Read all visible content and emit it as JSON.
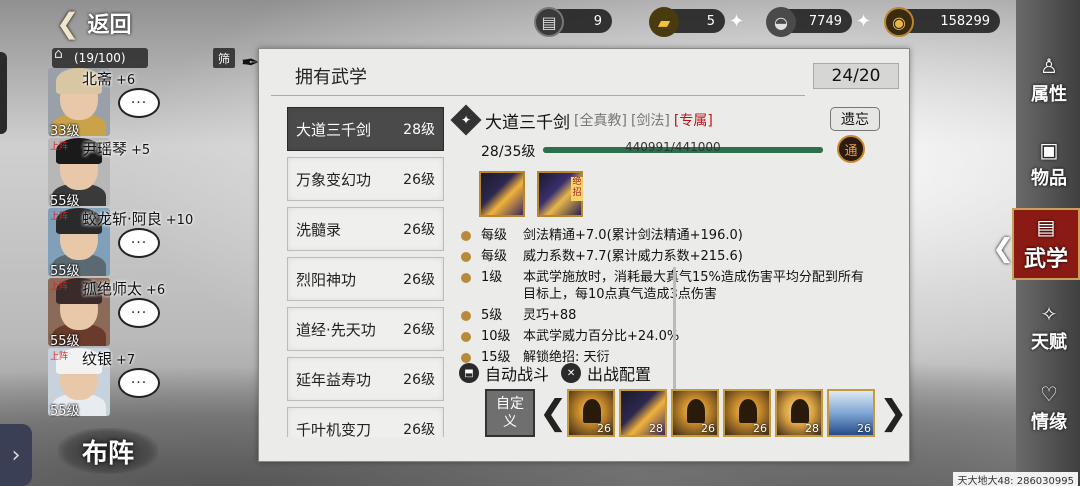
{
  "top": {
    "back_label": "返回",
    "resources": [
      {
        "icon": "cart-icon",
        "value": "9",
        "plus": false
      },
      {
        "icon": "gold-bar-icon",
        "value": "5",
        "plus": true
      },
      {
        "icon": "silver-ingot-icon",
        "value": "7749",
        "plus": true
      },
      {
        "icon": "coin-icon",
        "value": "158299",
        "plus": false
      }
    ]
  },
  "roster": {
    "count": "(19/100)",
    "filter_label": "筛",
    "heroes": [
      {
        "name": "北斋",
        "bonus": "+6",
        "level": "33级",
        "tag": ""
      },
      {
        "name": "尹瑶琴",
        "bonus": "+5",
        "level": "55级",
        "tag": "上阵"
      },
      {
        "name": "蛟龙斩·阿良",
        "bonus": "+10",
        "level": "55级",
        "tag": "上阵"
      },
      {
        "name": "孤绝师太",
        "bonus": "+6",
        "level": "55级",
        "tag": "上阵"
      },
      {
        "name": "纹银",
        "bonus": "+7",
        "level": "55级",
        "tag": "上阵"
      }
    ],
    "chat_label": "···",
    "formation_label": "布阵"
  },
  "panel": {
    "title": "拥有武学",
    "count": "24/20",
    "skills": [
      {
        "name": "大道三千剑",
        "level": "28级",
        "active": true
      },
      {
        "name": "万象变幻功",
        "level": "26级",
        "active": false
      },
      {
        "name": "洗髓录",
        "level": "26级",
        "active": false
      },
      {
        "name": "烈阳神功",
        "level": "26级",
        "active": false
      },
      {
        "name": "道经·先天功",
        "level": "26级",
        "active": false
      },
      {
        "name": "延年益寿功",
        "level": "26级",
        "active": false
      },
      {
        "name": "千叶机变刀",
        "level": "26级",
        "active": false
      }
    ],
    "detail": {
      "name": "大道三千剑",
      "tag1": "[全真教]",
      "tag2": "[剑法]",
      "tag3": "[专属]",
      "forget_label": "遗忘",
      "level_text": "28/35级",
      "xp_text": "440991/441000",
      "xp_fraction": 0.99998,
      "knob_label": "通",
      "ultimate_label": "绝招",
      "effects": [
        {
          "lvl": "每级",
          "txt": "剑法精通+7.0(累计剑法精通+196.0)"
        },
        {
          "lvl": "每级",
          "txt": "威力系数+7.7(累计威力系数+215.6)"
        },
        {
          "lvl": "1级",
          "txt": "本武学施放时，消耗最大真气15%造成伤害平均分配到所有目标上，每10点真气造成3点伤害"
        },
        {
          "lvl": "5级",
          "txt": "灵巧+88"
        },
        {
          "lvl": "10级",
          "txt": "本武学威力百分比+24.0%"
        },
        {
          "lvl": "15级",
          "txt": "解锁绝招:  天衍"
        }
      ]
    },
    "controls": {
      "auto_battle": "自动战斗",
      "battle_config": "出战配置",
      "custom_label": "自定义"
    },
    "slots": [
      {
        "kind": "figure",
        "num": "26"
      },
      {
        "kind": "skill",
        "num": "28"
      },
      {
        "kind": "figure",
        "num": "26"
      },
      {
        "kind": "figure",
        "num": "26"
      },
      {
        "kind": "jump",
        "num": "28"
      },
      {
        "kind": "water",
        "num": "26"
      }
    ]
  },
  "nav": [
    {
      "label": "属性",
      "icon": "gourd-icon",
      "active": false
    },
    {
      "label": "物品",
      "icon": "chest-icon",
      "active": false
    },
    {
      "label": "武学",
      "icon": "book-icon",
      "active": true
    },
    {
      "label": "天赋",
      "icon": "talent-icon",
      "active": false
    },
    {
      "label": "情缘",
      "icon": "heart-icon",
      "active": false
    }
  ],
  "footer": "天大地大48: 286030995"
}
